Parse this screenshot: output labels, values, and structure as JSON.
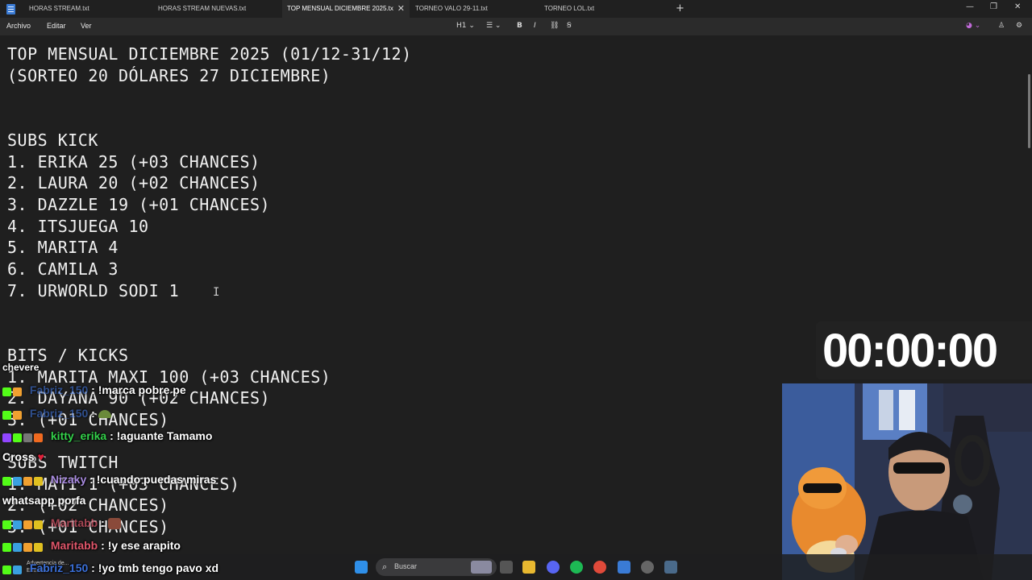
{
  "tabs": [
    {
      "label": "HORAS STREAM.txt",
      "active": false
    },
    {
      "label": "HORAS STREAM NUEVAS.txt",
      "active": false
    },
    {
      "label": "TOP MENSUAL DICIEMBRE 2025.tx",
      "active": true
    },
    {
      "label": "TORNEO VALO 29-11.txt",
      "active": false
    },
    {
      "label": "TORNEO LOL.txt",
      "active": false
    }
  ],
  "menu": {
    "archivo": "Archivo",
    "editar": "Editar",
    "ver": "Ver"
  },
  "toolbar": {
    "heading": "H1",
    "bold": "B",
    "italic": "I"
  },
  "document": {
    "lines": [
      "TOP MENSUAL DICIEMBRE 2025 (01/12-31/12)",
      "(SORTEO 20 DÓLARES 27 DICIEMBRE)",
      "",
      "",
      "SUBS KICK",
      "1. ERIKA 25 (+03 CHANCES)",
      "2. LAURA 20 (+02 CHANCES)",
      "3. DAZZLE 19 (+01 CHANCES)",
      "4. ITSJUEGA 10",
      "5. MARITA 4",
      "6. CAMILA 3",
      "7. URWORLD SODI 1",
      "",
      "",
      "BITS / KICKS",
      "1. MARITA MAXI 100 (+03 CHANCES)",
      "2. DAYANA 90 (+02 CHANCES)",
      "3. (+01 CHANCES)",
      "",
      "SUBS TWITCH",
      "1. MATI 1 (+03 CHANCES)",
      "2. (+02 CHANCES)",
      "3. (+01 CHANCES)"
    ]
  },
  "timer": "00:00:00",
  "chat": {
    "top_fragment": "chevere",
    "messages": [
      {
        "user": "Fabriz_150",
        "user_color": "#3a6fd8",
        "text": "!marca pobre pe",
        "continuation": ""
      },
      {
        "user": "Fabriz_150",
        "user_color": "#3a6fd8",
        "text": "",
        "continuation": ""
      },
      {
        "user": "kitty_erika",
        "user_color": "#33d14a",
        "text": "!aguante Tamamo",
        "continuation": "Cross"
      },
      {
        "user": "Nizaky",
        "user_color": "#a98be0",
        "text": "!cuando puedas miras",
        "continuation": "whatsapp porfa"
      },
      {
        "user": "Maritabb",
        "user_color": "#e0566a",
        "text": "",
        "continuation": ""
      },
      {
        "user": "Maritabb",
        "user_color": "#e0566a",
        "text": "!y ese arapito",
        "continuation": ""
      },
      {
        "user": "Fabriz_150",
        "user_color": "#3a6fd8",
        "text": "!yo tmb tengo pavo xd",
        "continuation": ""
      }
    ]
  },
  "taskbar": {
    "search": "Buscar",
    "warning_line1": "Advertencia de...",
    "warning_line2": "Entrada"
  }
}
